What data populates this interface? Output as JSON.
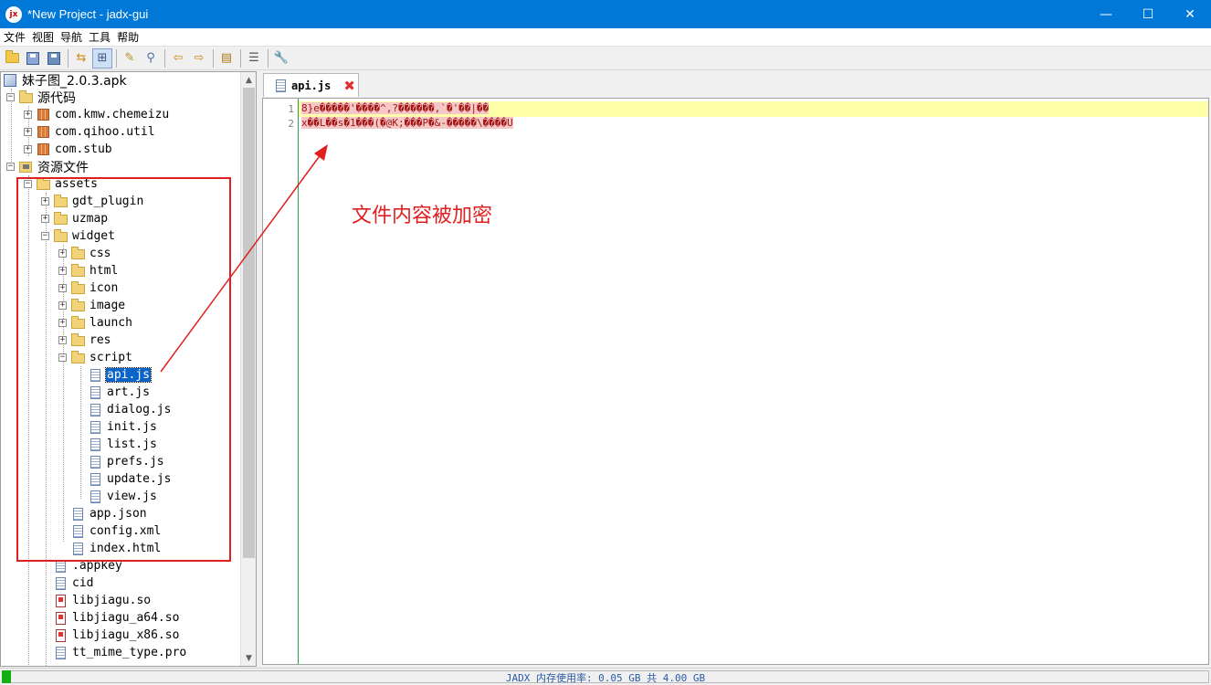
{
  "window": {
    "title": "*New Project - jadx-gui",
    "app_icon_text": "jx"
  },
  "window_controls": {
    "minimize": "—",
    "maximize": "☐",
    "close": "✕"
  },
  "menu": [
    "文件",
    "视图",
    "导航",
    "工具",
    "帮助"
  ],
  "toolbar_icons": [
    "open-file-icon",
    "add-files-icon",
    "save-all-icon",
    "sync-tree-icon",
    "flatten-packages-icon",
    "search-text-icon",
    "search-class-icon",
    "back-icon",
    "forward-icon",
    "decompile-all-icon",
    "log-icon",
    "preferences-icon"
  ],
  "tree": {
    "root": "妹子图_2.0.3.apk",
    "source_node": "源代码",
    "packages": [
      "com.kmw.chemeizu",
      "com.qihoo.util",
      "com.stub"
    ],
    "resources_node": "资源文件",
    "assets": "assets",
    "asset_folders": [
      "gdt_plugin",
      "uzmap"
    ],
    "widget": "widget",
    "widget_folders": [
      "css",
      "html",
      "icon",
      "image",
      "launch",
      "res"
    ],
    "script": "script",
    "script_files": [
      "api.js",
      "art.js",
      "dialog.js",
      "init.js",
      "list.js",
      "prefs.js",
      "update.js",
      "view.js"
    ],
    "widget_files": [
      "app.json",
      "config.xml",
      "index.html"
    ],
    "asset_files": [
      ".appkey",
      "cid",
      "libjiagu.so",
      "libjiagu_a64.so",
      "libjiagu_x86.so",
      "tt_mime_type.pro"
    ],
    "selected": "api.js"
  },
  "editor": {
    "tab_label": "api.js",
    "line_numbers": [
      "1",
      "2"
    ],
    "lines": [
      "8}e�����'����^,?������,`�'��|��",
      "x��L��s�1���(�@K;���P�&-�����\\����U"
    ]
  },
  "annotation": {
    "text": "文件内容被加密",
    "color": "#e02020"
  },
  "status": {
    "memory": "JADX 内存使用率: 0.05 GB 共 4.00 GB"
  },
  "colors": {
    "titlebar": "#0078d7",
    "selection": "#0a64c8",
    "highlight_line": "#ffffaa",
    "memory_bar": "#12b012"
  }
}
